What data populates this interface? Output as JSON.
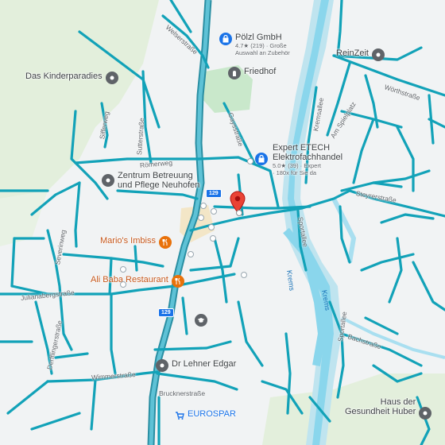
{
  "map": {
    "streets": {
      "welserstrasse": "Welserstraße",
      "sifferweg": "Sifferweg",
      "sutterstrasse": "Sutterstraße",
      "romerweg": "Römerweg",
      "severinweg": "Severinweg",
      "julianabergstrasse": "Julianabergstraße",
      "derfflingerstrasse": "Derfflingerstraße",
      "wimmerstrasse": "Wimmerstraße",
      "brucknerstrasse": "Brucknerstraße",
      "gaysstrasse": "Gaysstraße",
      "kremsallee": "Kremsallee",
      "am_spielplatz": "Am Spielplatz",
      "worthstrasse": "Wörthstraße",
      "steyrerstrasse": "Steyrerstraße",
      "sportallee_1": "Sportallee",
      "sportallee_2": "Sportallee",
      "bachstrasse": "Bachstraße"
    },
    "water": {
      "krems_1": "Krems",
      "krems_2": "Krems"
    },
    "route_shields": {
      "r1": "129",
      "r2": "129"
    },
    "pois": {
      "polzl": {
        "name": "Pölzl GmbH",
        "rating": "4.7★ (219) · Große",
        "desc": "Auswahl an Zubehör",
        "icon": "shopping-bag-icon"
      },
      "friedhof": {
        "name": "Friedhof",
        "icon": "cemetery-icon"
      },
      "reinzeit": {
        "name": "ReinZeit",
        "icon": "place-icon"
      },
      "kinderparadies": {
        "name": "Das Kinderparadies",
        "icon": "place-icon"
      },
      "expert": {
        "name_line1": "Expert ETECH",
        "name_line2": "Elektrofachhandel",
        "rating": "5.0★ (39) · Expert",
        "desc": "· 180x für Sie da",
        "icon": "shopping-bag-icon"
      },
      "zentrum": {
        "name_line1": "Zentrum Betreuung",
        "name_line2": "und Pflege Neuhofen",
        "icon": "place-icon"
      },
      "marios": {
        "name": "Mario's Imbiss",
        "icon": "restaurant-icon"
      },
      "alibaba": {
        "name": "Ali Baba Restaurant",
        "icon": "restaurant-icon"
      },
      "lehner": {
        "name": "Dr Lehner Edgar",
        "icon": "place-icon"
      },
      "eurospar": {
        "name": "EUROSPAR",
        "icon": "cart-icon"
      },
      "gesundheit": {
        "name_line1": "Haus der",
        "name_line2": "Gesundheit Huber",
        "icon": "place-icon"
      },
      "school": {
        "icon": "graduation-cap-icon"
      }
    },
    "colors": {
      "road": "#12a2b8",
      "highway": "#4fb3c8",
      "river": "#8ad6ec",
      "park": "#cfeacf",
      "forest": "#e2f0dc",
      "background": "#f1f3f4",
      "marker": "#ea4335"
    }
  }
}
